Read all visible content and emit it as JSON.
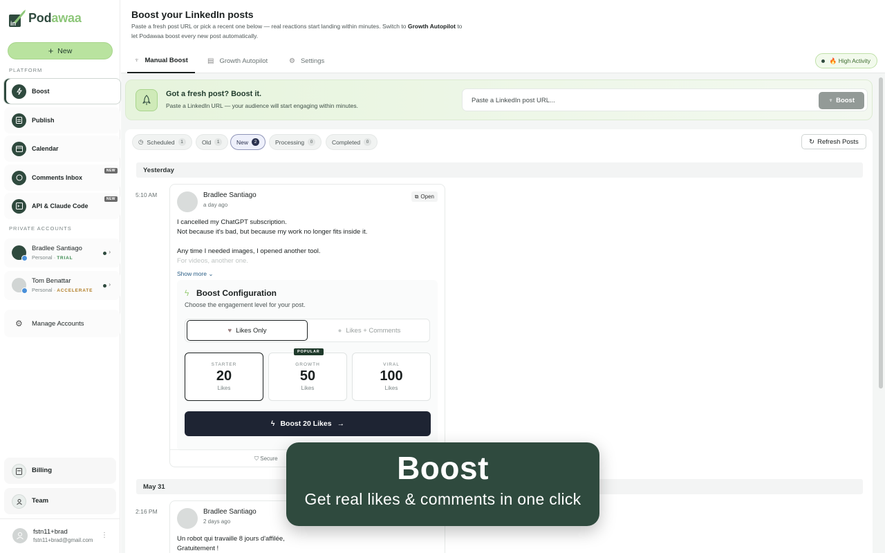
{
  "brand": {
    "name_part1": "Pod",
    "name_part2": "awaa"
  },
  "sidebar": {
    "new_label": "New",
    "platform_label": "PLATFORM",
    "nav": [
      {
        "label": "Boost",
        "icon": "bolt-icon"
      },
      {
        "label": "Publish",
        "icon": "document-icon"
      },
      {
        "label": "Calendar",
        "icon": "calendar-icon"
      },
      {
        "label": "Comments Inbox",
        "icon": "chat-bubble-icon",
        "badge": "NEW"
      },
      {
        "label": "API & Claude Code",
        "icon": "terminal-icon",
        "badge": "NEW"
      }
    ],
    "private_label": "PRIVATE ACCOUNTS",
    "accounts": [
      {
        "name": "Bradlee Santiago",
        "type": "Personal",
        "tier": "TRIAL"
      },
      {
        "name": "Tom Benattar",
        "type": "Personal",
        "tier": "ACCELERATE"
      }
    ],
    "manage_label": "Manage Accounts",
    "billing_label": "Billing",
    "team_label": "Team",
    "user": {
      "name": "fstn11+brad",
      "email": "fstn11+brad@gmail.com"
    }
  },
  "header": {
    "title": "Boost your LinkedIn posts",
    "desc_a": "Paste a fresh post URL or pick a recent one below — real reactions start landing within minutes. Switch to ",
    "desc_b": "Growth Autopilot",
    "desc_c": " to let Podawaa boost every new post automatically."
  },
  "tabs": [
    {
      "label": "Manual Boost",
      "icon": "rocket-icon"
    },
    {
      "label": "Growth Autopilot",
      "icon": "document-icon"
    },
    {
      "label": "Settings",
      "icon": "gear-icon"
    }
  ],
  "activity_badge": "🔥 High Activity",
  "hero": {
    "title": "Got a fresh post? Boost it.",
    "subtitle": "Paste a LinkedIn URL — your audience will start engaging within minutes.",
    "placeholder": "Paste a LinkedIn post URL...",
    "button": "Boost"
  },
  "filters": [
    {
      "label": "Scheduled",
      "count": "1"
    },
    {
      "label": "Old",
      "count": "1"
    },
    {
      "label": "New",
      "count": "2"
    },
    {
      "label": "Processing",
      "count": "0"
    },
    {
      "label": "Completed",
      "count": "0"
    }
  ],
  "refresh_label": "Refresh Posts",
  "groups": [
    {
      "day": "Yesterday",
      "time": "5:10 AM"
    },
    {
      "day": "May 31",
      "time": "2:16 PM"
    }
  ],
  "post1": {
    "author": "Bradlee Santiago",
    "ago": "a day ago",
    "open_label": "Open",
    "line1": "I cancelled my ChatGPT subscription.",
    "line2": "Not because it's bad, but because my work no longer fits inside it.",
    "line3": "Any time I needed images, I opened another tool.",
    "line4": "For videos, another one.",
    "show_more": "Show more"
  },
  "config": {
    "title": "Boost Configuration",
    "subtitle": "Choose the engagement level for your post.",
    "opt_on": "Likes Only",
    "opt_off": "Likes + Comments",
    "tiers": [
      {
        "name": "STARTER",
        "value": "20",
        "unit": "Likes"
      },
      {
        "name": "GROWTH",
        "value": "50",
        "unit": "Likes",
        "tag": "POPULAR"
      },
      {
        "name": "VIRAL",
        "value": "100",
        "unit": "Likes"
      }
    ],
    "cta": "Boost 20 Likes",
    "secure": "Secure"
  },
  "post2": {
    "author": "Bradlee Santiago",
    "ago": "2 days ago",
    "line1": "Un robot qui travaille 8 jours d'affilée,",
    "line2": "Gratuitement !"
  },
  "toast": {
    "title": "Boost",
    "subtitle": "Get real likes & comments in one click"
  },
  "colors": {
    "brand_dark": "#2f4a3e",
    "brand_light": "#b9e39f",
    "cta": "#1e2433"
  }
}
